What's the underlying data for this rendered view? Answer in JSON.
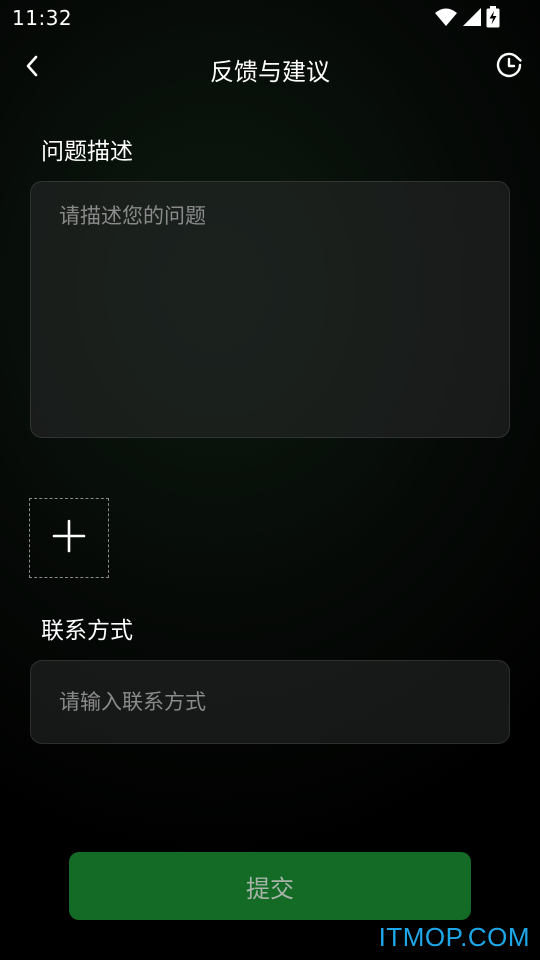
{
  "status_bar": {
    "time": "11:32",
    "icons": [
      "wifi-icon",
      "cell-signal-icon",
      "battery-charging-icon"
    ]
  },
  "header": {
    "title": "反馈与建议",
    "back_icon": "chevron-left-icon",
    "history_icon": "clock-history-icon"
  },
  "problem": {
    "label": "问题描述",
    "placeholder": "请描述您的问题",
    "value": ""
  },
  "attachment": {
    "icon": "plus-icon"
  },
  "contact": {
    "label": "联系方式",
    "placeholder": "请输入联系方式",
    "value": ""
  },
  "submit": {
    "label": "提交"
  },
  "watermark": "ITMOP.COM",
  "colors": {
    "background": "#000000",
    "submit_bg": "#136b25",
    "submit_text": "#a9b4aa",
    "placeholder": "#8a8a8a",
    "watermark": "#1ea7e8"
  }
}
